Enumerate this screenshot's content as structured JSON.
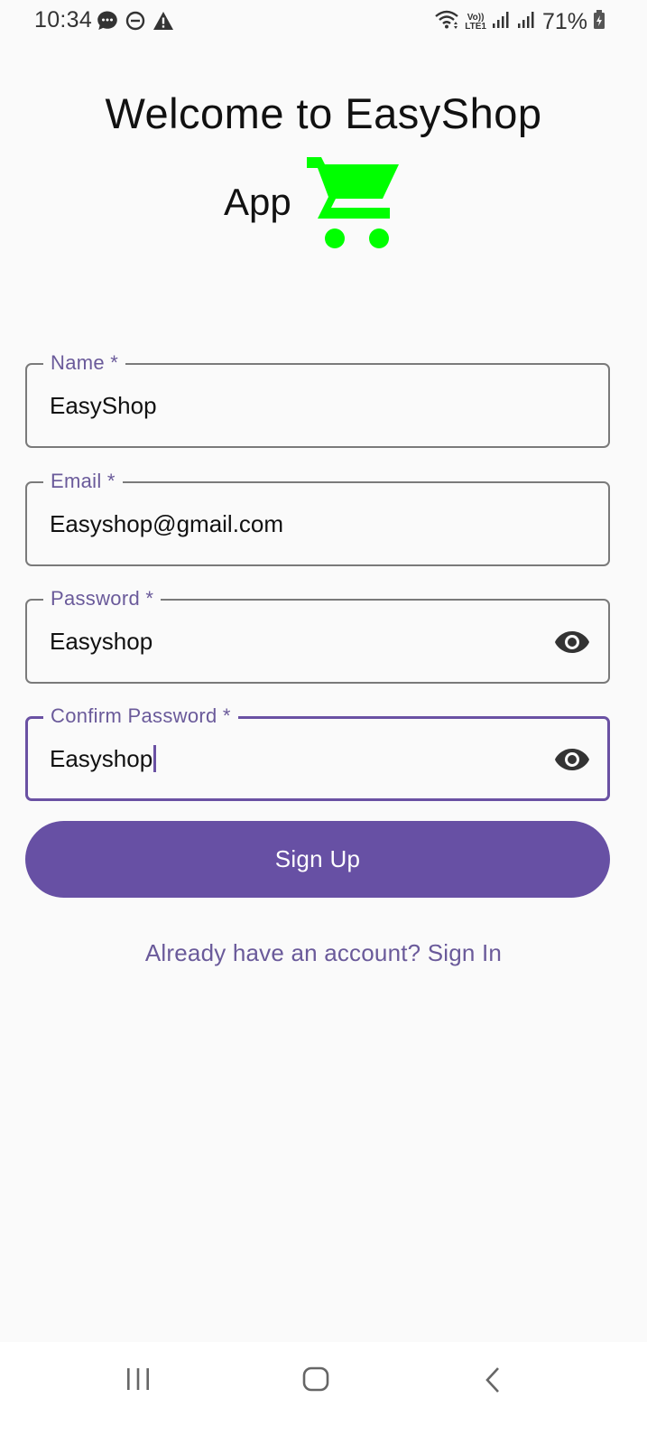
{
  "status_bar": {
    "time": "10:34",
    "left_icons": [
      "message-icon",
      "do-not-disturb-icon",
      "alert-icon"
    ],
    "network_label_top": "Vo))",
    "network_label_bottom": "LTE1",
    "battery_percent": "71%"
  },
  "header": {
    "title_line1": "Welcome to EasyShop",
    "title_line2": "App",
    "cart_icon_color": "#00ff00"
  },
  "form": {
    "name": {
      "label": "Name *",
      "value": "EasyShop"
    },
    "email": {
      "label": "Email *",
      "value": "Easyshop@gmail.com"
    },
    "password": {
      "label": "Password *",
      "value": "Easyshop"
    },
    "confirm_password": {
      "label": "Confirm Password *",
      "value": "Easyshop"
    }
  },
  "actions": {
    "signup_label": "Sign Up",
    "signin_link": "Already have an account? Sign In"
  },
  "colors": {
    "primary": "#6750a4",
    "label": "#6a5a9a",
    "cart": "#00ff00"
  },
  "nav": {
    "items": [
      "recent-apps-icon",
      "home-icon",
      "back-icon"
    ]
  }
}
